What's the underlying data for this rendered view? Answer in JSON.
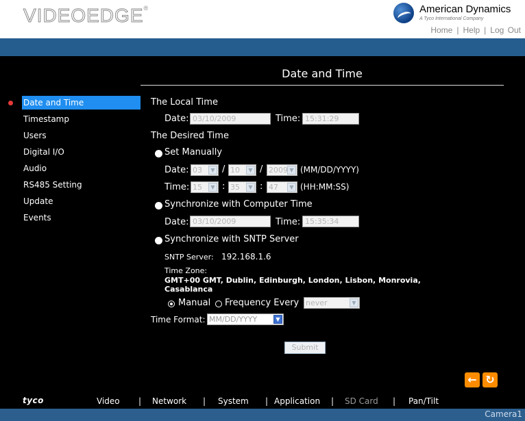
{
  "header": {
    "logo": "VIDEOEDGE",
    "logo_mark": "®",
    "brand_name": "American Dynamics",
    "brand_sub": "A Tyco International Company",
    "links": [
      "Home",
      "Help",
      "Log Out"
    ]
  },
  "page_title": "Date and Time",
  "sidebar": {
    "items": [
      {
        "label": "Date and Time",
        "active": true
      },
      {
        "label": "Timestamp"
      },
      {
        "label": "Users"
      },
      {
        "label": "Digital I/O"
      },
      {
        "label": "Audio"
      },
      {
        "label": "RS485 Setting"
      },
      {
        "label": "Update"
      },
      {
        "label": "Events"
      }
    ]
  },
  "form": {
    "local_time_heading": "The Local Time",
    "date_label": "Date:",
    "time_label": "Time:",
    "local_date": "03/10/2009",
    "local_time": "15:31:29",
    "desired_time_heading": "The Desired Time",
    "set_manually_label": "Set Manually",
    "manual_month": "03",
    "manual_day": "10",
    "manual_year": "2009",
    "date_slash": "/",
    "date_format_hint": "(MM/DD/YYYY)",
    "manual_hour": "15",
    "manual_minute": "35",
    "manual_second": "47",
    "time_colon": ":",
    "time_format_hint": "(HH:MM:SS)",
    "sync_computer_label": "Synchronize with Computer Time",
    "computer_date": "03/10/2009",
    "computer_time": "15:35:34",
    "sync_sntp_label": "Synchronize with SNTP Server",
    "sntp_server_label": "SNTP Server:",
    "sntp_server_value": "192.168.1.6",
    "time_zone_label": "Time Zone:",
    "time_zone_line1": "GMT+00 GMT, Dublin, Edinburgh, London, Lisbon, Monrovia,",
    "time_zone_line2": "Casablanca",
    "manual_option": "Manual",
    "frequency_option": "Frequency Every",
    "frequency_value": "never",
    "time_format_label": "Time Format:",
    "time_format_value": "MM/DD/YYYY",
    "submit_label": "Submit"
  },
  "nav_buttons": {
    "back": "←",
    "refresh": "↻"
  },
  "footer": {
    "logo": "tyco",
    "items": [
      {
        "label": "Video",
        "enabled": true
      },
      {
        "label": "Network",
        "enabled": true
      },
      {
        "label": "System",
        "enabled": true
      },
      {
        "label": "Application",
        "enabled": true
      },
      {
        "label": "SD Card",
        "enabled": false
      },
      {
        "label": "Pan/Tilt",
        "enabled": true
      }
    ],
    "separator": "|"
  },
  "status": {
    "camera_name": "Camera1"
  },
  "colors": {
    "header_bar": "#255d8f",
    "active_item": "#1f8ef0",
    "accent_orange": "#ff8c00",
    "status_bar": "#2c5f8e"
  }
}
